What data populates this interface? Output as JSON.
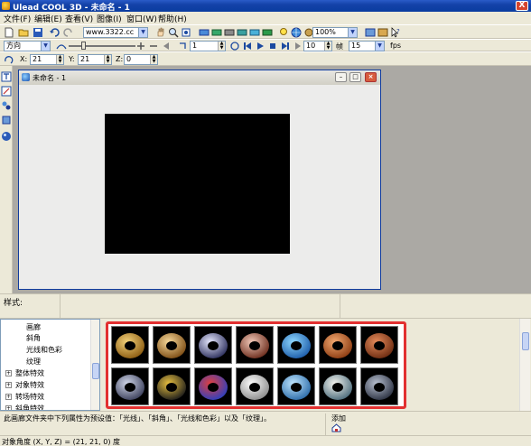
{
  "window": {
    "title": "Ulead COOL 3D - 未命名 - 1",
    "close_label": "X"
  },
  "menu": {
    "items": [
      {
        "label": "文件(F)"
      },
      {
        "label": "编辑(E)"
      },
      {
        "label": "查看(V)"
      },
      {
        "label": "图像(I)"
      },
      {
        "label": "窗口(W)"
      },
      {
        "label": "帮助(H)"
      }
    ]
  },
  "toolbar": {
    "font_combo": "www.3322.cc",
    "zoom_combo": "100%",
    "frame_value": "1",
    "frames_total": "10",
    "frames_label": "帧",
    "fps_value": "15",
    "fps_label": "fps",
    "direction_combo": "方向"
  },
  "attributes": {
    "x_label": "X:",
    "x_value": "21",
    "y_label": "Y:",
    "y_value": "21",
    "z_label": "Z:",
    "z_value": "0"
  },
  "document": {
    "title": "未命名 - 1",
    "stage_color": "#000000"
  },
  "style_bar": {
    "label": "样式:"
  },
  "tree": {
    "items": [
      {
        "label": "画廊",
        "expandable": false
      },
      {
        "label": "斜角",
        "expandable": false
      },
      {
        "label": "光线和色彩",
        "expandable": false
      },
      {
        "label": "纹理",
        "expandable": false
      },
      {
        "label": "整体特效",
        "expandable": true
      },
      {
        "label": "对象特效",
        "expandable": true
      },
      {
        "label": "转场特效",
        "expandable": true
      },
      {
        "label": "斜角特效",
        "expandable": true
      }
    ]
  },
  "gallery": {
    "highlight_color": "#e23030",
    "thumbnails": [
      {
        "name": "gold-ring",
        "c1": "#f3d27a",
        "c2": "#8a5a10"
      },
      {
        "name": "bronze-ring",
        "c1": "#f7d99a",
        "c2": "#7a4a12"
      },
      {
        "name": "chrome-ring",
        "c1": "#e6e8ff",
        "c2": "#2a2d5a"
      },
      {
        "name": "copper-ring",
        "c1": "#f0c8b8",
        "c2": "#6a2a1a"
      },
      {
        "name": "blue-bubble-ring",
        "c1": "#8fd8ff",
        "c2": "#1a5aa8"
      },
      {
        "name": "orange-pattern-ring",
        "c1": "#f2a870",
        "c2": "#8a3a10"
      },
      {
        "name": "rust-ring",
        "c1": "#e48a5a",
        "c2": "#6a2a10"
      },
      {
        "name": "steel-dotted-ring",
        "c1": "#d0d6e8",
        "c2": "#3a3e5a"
      },
      {
        "name": "gold-sparkle-ring",
        "c1": "#e8c040",
        "c2": "#1a1a1a"
      },
      {
        "name": "stained-glass-ring",
        "c1": "#e04040",
        "c2": "#2a40c0"
      },
      {
        "name": "white-marble-ring",
        "c1": "#ffffff",
        "c2": "#8a8a8a"
      },
      {
        "name": "sky-blue-ring",
        "c1": "#bfe6ff",
        "c2": "#2a6aa8"
      },
      {
        "name": "pearl-ring",
        "c1": "#f4f4ee",
        "c2": "#4a6a7a"
      },
      {
        "name": "dark-steel-ring",
        "c1": "#b8c0d0",
        "c2": "#2a3040"
      }
    ]
  },
  "description": {
    "text": "此画廊文件夹中下列属性为预设值：「光线」、「斜角」、「光线和色彩」以及「纹理」。",
    "add_label": "添加"
  },
  "status": {
    "text": "对象角度 (X, Y, Z) = (21, 21, 0) 度"
  }
}
